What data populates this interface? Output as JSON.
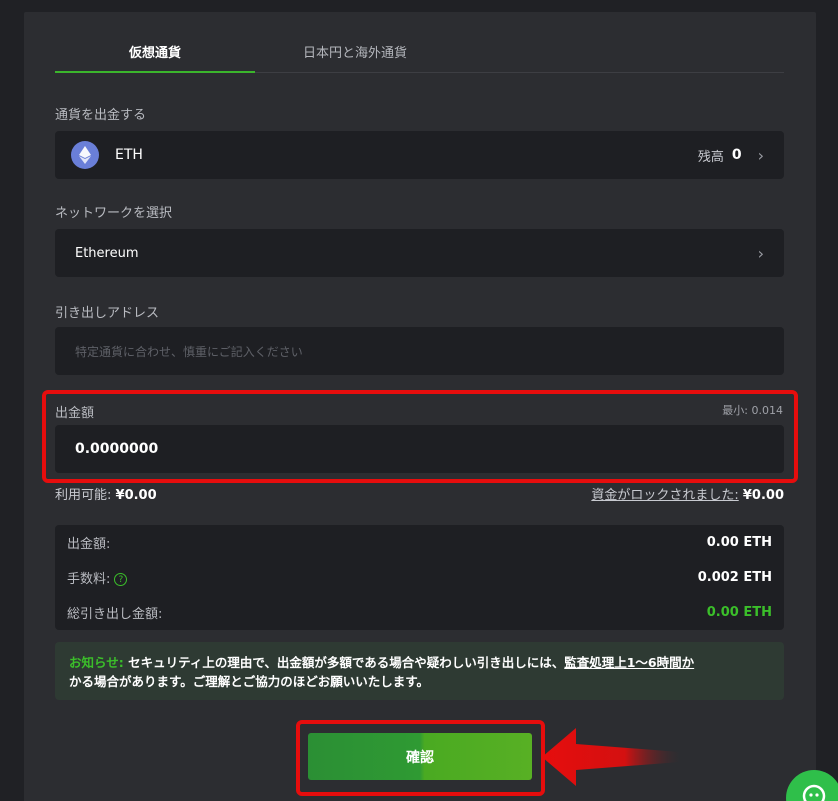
{
  "tabs": [
    {
      "label": "仮想通貨",
      "active": true
    },
    {
      "label": "日本円と海外通貨",
      "active": false
    }
  ],
  "currency": {
    "label": "通貨を出金する",
    "name": "ETH",
    "icon": "ethereum-icon",
    "balance_label": "残高",
    "balance_value": "0"
  },
  "network": {
    "label": "ネットワークを選択",
    "value": "Ethereum"
  },
  "address": {
    "label": "引き出しアドレス",
    "placeholder": "特定通貨に合わせ、慎重にご記入ください"
  },
  "amount": {
    "label": "出金額",
    "min_text": "最小: 0.014",
    "value": "0.0000000"
  },
  "availability": {
    "available_label": "利用可能:",
    "available_value": "¥0.00",
    "locked_label": "資金がロックされました:",
    "locked_value": "¥0.00"
  },
  "summary": {
    "amount_label": "出金額:",
    "amount_value": "0.00 ETH",
    "fee_label": "手数料:",
    "fee_value": "0.002 ETH",
    "total_label": "総引き出し金額:",
    "total_value": "0.00 ETH"
  },
  "notice": {
    "head": "お知らせ:",
    "body1": " セキュリティ上の理由で、出金額が多額である場合や疑わしい引き出しには、",
    "underlined": "監査処理上1～6時間か",
    "body2": "かる場合があります。ご理解とご協力のほどお願いいたします。"
  },
  "confirm_label": "確認",
  "colors": {
    "accent_green": "#3bbf2a",
    "highlight_red": "#e60d0d",
    "panel_bg": "#2c2d31"
  }
}
